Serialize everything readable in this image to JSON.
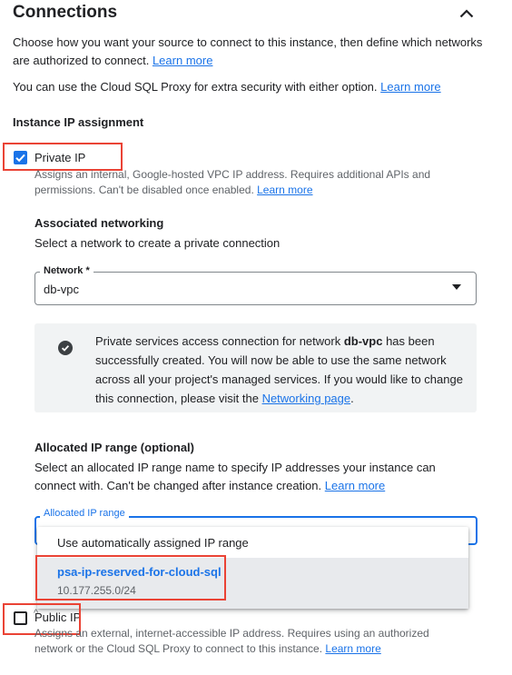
{
  "section": {
    "title": "Connections",
    "intro": "Choose how you want your source to connect to this instance, then define which networks are authorized to connect.",
    "intro_link": "Learn more",
    "proxy_text": "You can use the Cloud SQL Proxy for extra security with either option.",
    "proxy_link": "Learn more"
  },
  "ip_assignment": {
    "heading": "Instance IP assignment",
    "private_ip": {
      "label": "Private IP",
      "checked": true,
      "help": "Assigns an internal, Google-hosted VPC IP address. Requires additional APIs and permissions. Can't be disabled once enabled.",
      "help_link": "Learn more"
    },
    "public_ip": {
      "label": "Public IP",
      "checked": false,
      "help": "Assigns an external, internet-accessible IP address. Requires using an authorized network or the Cloud SQL Proxy to connect to this instance.",
      "help_link": "Learn more"
    }
  },
  "networking": {
    "heading": "Associated networking",
    "description": "Select a network to create a private connection",
    "network_label": "Network *",
    "network_value": "db-vpc"
  },
  "info": {
    "text_before": "Private services access connection for network ",
    "network_name": "db-vpc",
    "text_after": " has been successfully created. You will now be able to use the same network across all your project's managed services. If you would like to change this connection, please visit the ",
    "link": "Networking page",
    "text_end": "."
  },
  "ip_range": {
    "heading": "Allocated IP range (optional)",
    "description": "Select an allocated IP range name to specify IP addresses your instance can connect with. Can't be changed after instance creation.",
    "description_link": "Learn more",
    "field_label": "Allocated IP range",
    "options": [
      {
        "label": "Use automatically assigned IP range"
      },
      {
        "label": "psa-ip-reserved-for-cloud-sql",
        "sub": "10.177.255.0/24"
      }
    ]
  },
  "colors": {
    "accent": "#1a73e8",
    "highlight": "#ea4335",
    "info_bg": "#f1f3f4"
  }
}
